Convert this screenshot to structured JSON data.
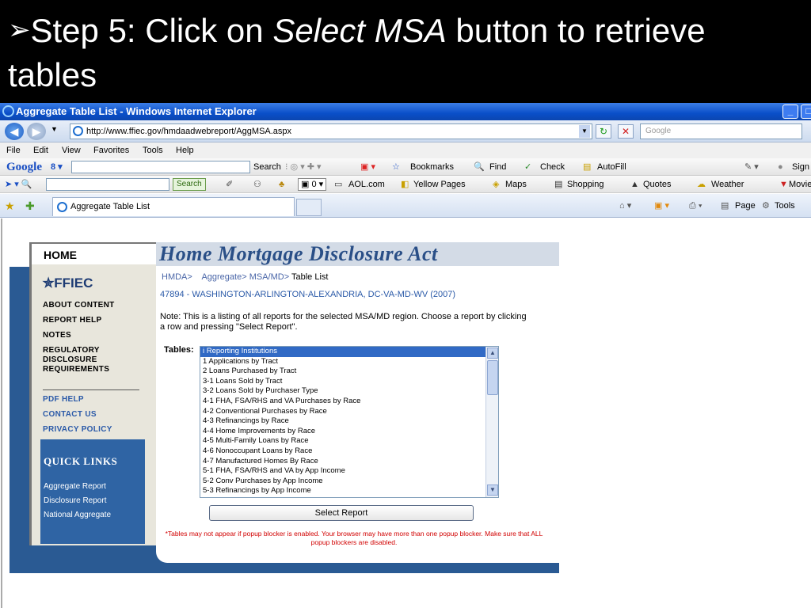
{
  "slide": {
    "arrow": "➢",
    "title_prefix": "Step 5: Click on ",
    "title_em": "Select MSA",
    "title_suffix": " button to retrieve tables"
  },
  "window": {
    "title": "Aggregate Table List - Windows Internet Explorer",
    "url": "http://www.ffiec.gov/hmdaadwebreport/AggMSA.aspx",
    "search_placeholder": "Google",
    "tab_label": "Aggregate Table List"
  },
  "menu": [
    "File",
    "Edit",
    "View",
    "Favorites",
    "Tools",
    "Help"
  ],
  "google_toolbar": {
    "logo": "Google",
    "search": "Search",
    "bookmarks": "Bookmarks",
    "find": "Find",
    "check": "Check",
    "autofill": "AutoFill",
    "sign": "Sign"
  },
  "aol_toolbar": {
    "search_btn": "Search",
    "mail_count": "0",
    "aol": "AOL.com",
    "yellow_pages": "Yellow Pages",
    "maps": "Maps",
    "shopping": "Shopping",
    "quotes": "Quotes",
    "weather": "Weather",
    "movies": "Movie"
  },
  "favbar": {
    "page": "Page",
    "tools": "Tools"
  },
  "site": {
    "home_tab": "HOME",
    "logo": "✮FFIEC",
    "banner": "Home Mortgage Disclosure Act",
    "sidebar_links": [
      "ABOUT CONTENT",
      "REPORT HELP",
      "NOTES",
      "REGULATORY DISCLOSURE REQUIREMENTS"
    ],
    "help_links": [
      "PDF HELP",
      "CONTACT US",
      "PRIVACY POLICY"
    ],
    "quick_links_title": "QUICK LINKS",
    "quick_links": [
      "Aggregate Report",
      "Disclosure Report",
      "National Aggregate"
    ],
    "breadcrumb": {
      "hmda": "HMDA>",
      "aggregate": "Aggregate>",
      "msa": "MSA/MD>",
      "current": "Table List"
    },
    "msa_name": "47894 - WASHINGTON-ARLINGTON-ALEXANDRIA, DC-VA-MD-WV (2007)",
    "note": "Note: This is a listing of all reports for the selected MSA/MD region. Choose a report by clicking a row and pressing \"Select Report\".",
    "tables_label": "Tables:",
    "tables": [
      "i Reporting Institutions",
      "1 Applications by Tract",
      "2 Loans Purchased by Tract",
      "3-1 Loans Sold by Tract",
      "3-2 Loans Sold by Purchaser Type",
      "4-1 FHA, FSA/RHS and VA Purchases by Race",
      "4-2 Conventional Purchases by Race",
      "4-3 Refinancings by Race",
      "4-4 Home Improvements by Race",
      "4-5 Multi-Family Loans by Race",
      "4-6 Nonoccupant Loans by Race",
      "4-7 Manufactured Homes By Race",
      "5-1 FHA, FSA/RHS and VA by App Income",
      "5-2 Conv Purchases by App Income",
      "5-3 Refinancings by App Income"
    ],
    "selected_index": 0,
    "select_button": "Select Report",
    "warning": "*Tables may not appear if popup blocker is enabled. Your browser may have more than one popup blocker. Make sure that ALL popup blockers are disabled."
  }
}
